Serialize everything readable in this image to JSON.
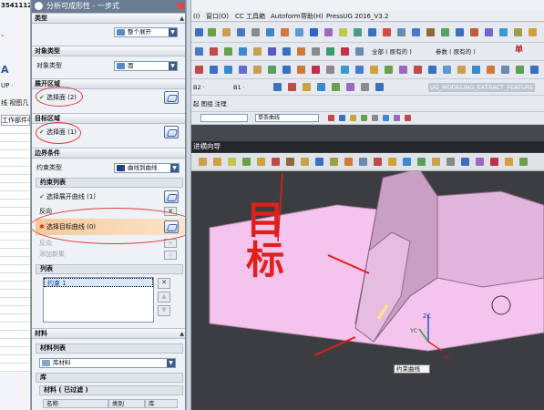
{
  "left_strip": {
    "id_text": "3541112",
    "items": [
      "-",
      "A",
      "UP ·",
      "线 视图几",
      "工作部件中"
    ]
  },
  "dialog": {
    "title": "分析可成形性 - 一步式",
    "type_section": "类型",
    "type_value": "整个展开",
    "object_type_section": "对象类型",
    "object_type_label": "对象类型",
    "object_type_value": "面",
    "unfold_region_section": "展开区域",
    "unfold_region_select": "选择面 (2)",
    "target_region_section": "目标区域",
    "target_region_select": "选择面 (1)",
    "boundary_section": "边界条件",
    "constraint_type_label": "约束类型",
    "constraint_type_value": "曲线到曲线",
    "constraint_list_header": "约束列表",
    "select_unfold_curve": "选择展开曲线 (1)",
    "reverse_1": "反向",
    "select_target_curve": "选择目标曲线 (0)",
    "reverse_2": "反向",
    "add_new_set": "添加新集",
    "list_header": "列表",
    "list_item": "约束 1",
    "material_section": "材料",
    "material_list_header": "材料列表",
    "material_value": "库材料",
    "library_header": "库",
    "material_filtered_header": "材料 ( 已过滤 )",
    "col_name": "名称",
    "col_category": "类别",
    "col_library": "库"
  },
  "menubar": {
    "items": [
      "(I)",
      "窗口(O)",
      "CC 工具箱",
      "Autoform",
      "帮助(H)",
      "PressUG 2016_V3.2"
    ]
  },
  "toolbar": {
    "all_label": "全部 ( 原有的 )",
    "param_label": "参数 ( 原有的 )",
    "single_label": "单",
    "extract_feature": "UG_MODELING_EXTRACT_FEATURE",
    "sec_b2": "B2 ·",
    "sec_b1": "B1 ·",
    "view_items": "起 图组 注理",
    "multi_curve": "单条曲线"
  },
  "viewport": {
    "nav_title": "进横向导",
    "annotation": "目标",
    "axis_zc": "ZC",
    "axis_yc": "YC",
    "axis_xc": "XC",
    "tooltip": "约束曲线"
  },
  "colors": {
    "dialog_title_bg": "#6b7d93",
    "highlight": "#f5c99a",
    "annotation_red": "#e0201a",
    "model_pink": "#f4c3ee",
    "viewport_bg": "#3b3d40"
  }
}
